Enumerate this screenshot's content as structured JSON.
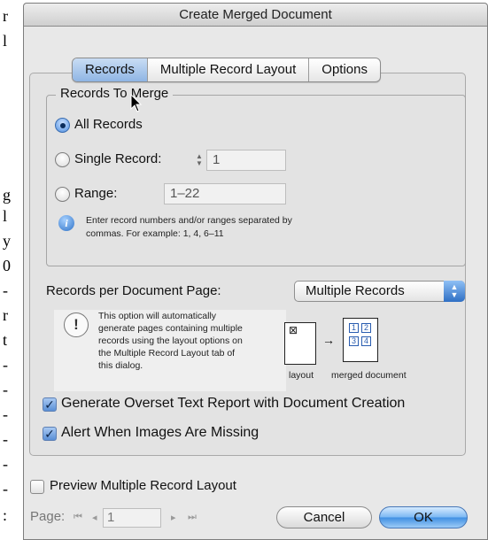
{
  "window": {
    "title": "Create Merged Document"
  },
  "tabs": [
    {
      "label": "Records",
      "active": true
    },
    {
      "label": "Multiple Record Layout",
      "active": false
    },
    {
      "label": "Options",
      "active": false
    }
  ],
  "records_to_merge": {
    "title": "Records To Merge",
    "all_records": {
      "label": "All Records",
      "selected": true
    },
    "single_record": {
      "label": "Single Record:",
      "value": "1",
      "selected": false
    },
    "range": {
      "label": "Range:",
      "value": "1–22",
      "selected": false
    },
    "hint": [
      "Enter record numbers and/or ranges separated by",
      "commas. For example: 1, 4, 6–11"
    ]
  },
  "records_per_page": {
    "label": "Records per Document Page:",
    "value": "Multiple Records"
  },
  "note": {
    "lines": [
      "This option will automatically",
      "generate pages containing multiple",
      "records using the layout options on",
      "the Multiple Record Layout tab of",
      "this dialog."
    ]
  },
  "diagram": {
    "layout_label": "layout",
    "merged_label": "merged document",
    "cells": [
      "1",
      "2",
      "3",
      "4"
    ],
    "arrow": "→",
    "frame_glyph": "⊠"
  },
  "checkboxes": {
    "overset": {
      "label": "Generate Overset Text Report with Document Creation",
      "checked": true
    },
    "images": {
      "label": "Alert When Images Are Missing",
      "checked": true
    },
    "preview": {
      "label": "Preview Multiple Record Layout",
      "checked": false
    }
  },
  "pager": {
    "label": "Page:",
    "value": "1",
    "first": "⏮",
    "prev": "◂",
    "next": "▸",
    "last": "⏭"
  },
  "buttons": {
    "cancel": "Cancel",
    "ok": "OK"
  },
  "left_strip": [
    "r",
    "l",
    "g",
    "l",
    "y",
    "0",
    "-",
    "r",
    "t",
    "-",
    "-",
    "-",
    "-",
    "-",
    "-",
    ":"
  ],
  "colors": {
    "accent": "#4d8ee0",
    "tab_active": "#a9c8ee"
  }
}
